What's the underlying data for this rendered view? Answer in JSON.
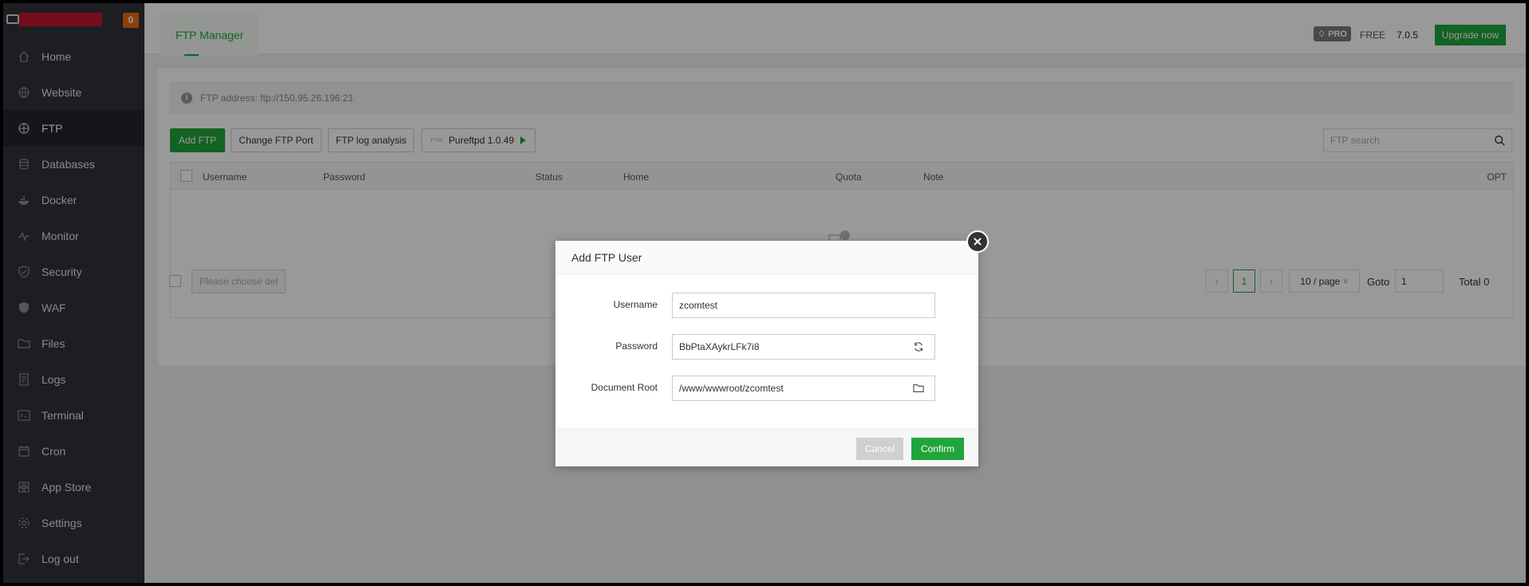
{
  "sidebar": {
    "badge": "0",
    "items": [
      {
        "label": "Home",
        "icon": "home-icon"
      },
      {
        "label": "Website",
        "icon": "globe-icon"
      },
      {
        "label": "FTP",
        "icon": "ftp-icon",
        "active": true
      },
      {
        "label": "Databases",
        "icon": "database-icon"
      },
      {
        "label": "Docker",
        "icon": "docker-icon"
      },
      {
        "label": "Monitor",
        "icon": "monitor-icon"
      },
      {
        "label": "Security",
        "icon": "shield-icon"
      },
      {
        "label": "WAF",
        "icon": "waf-icon"
      },
      {
        "label": "Files",
        "icon": "folder-icon"
      },
      {
        "label": "Logs",
        "icon": "logs-icon"
      },
      {
        "label": "Terminal",
        "icon": "terminal-icon"
      },
      {
        "label": "Cron",
        "icon": "calendar-icon"
      },
      {
        "label": "App Store",
        "icon": "grid-icon"
      },
      {
        "label": "Settings",
        "icon": "gear-icon"
      },
      {
        "label": "Log out",
        "icon": "logout-icon"
      }
    ]
  },
  "header": {
    "tab": "FTP Manager",
    "pro": "PRO",
    "free": "FREE",
    "version": "7.0.5",
    "upgrade": "Upgrade now"
  },
  "ftp": {
    "address": "FTP address: ftp://150.95.26.196:21",
    "buttons": {
      "add": "Add FTP",
      "port": "Change FTP Port",
      "log": "FTP log analysis",
      "pure_tag": "FTM",
      "pure": "Pureftpd 1.0.49"
    },
    "search_placeholder": "FTP search",
    "columns": [
      "Username",
      "Password",
      "Status",
      "Home",
      "Quota",
      "Note",
      "OPT"
    ],
    "footer": {
      "batch_placeholder": "Please choose del",
      "page": "1",
      "per_page": "10 / page",
      "goto_label": "Goto",
      "goto_value": "1",
      "total": "Total 0"
    }
  },
  "dialog": {
    "title": "Add FTP User",
    "username_label": "Username",
    "username_value": "zcomtest",
    "password_label": "Password",
    "password_value": "BbPtaXAykrLFk7i8",
    "docroot_label": "Document Root",
    "docroot_value": "/www/wwwroot/zcomtest",
    "cancel": "Cancel",
    "confirm": "Confirm"
  },
  "colors": {
    "accent": "#20a53a",
    "sidebar": "#30333a",
    "badge": "#ec6c12"
  }
}
